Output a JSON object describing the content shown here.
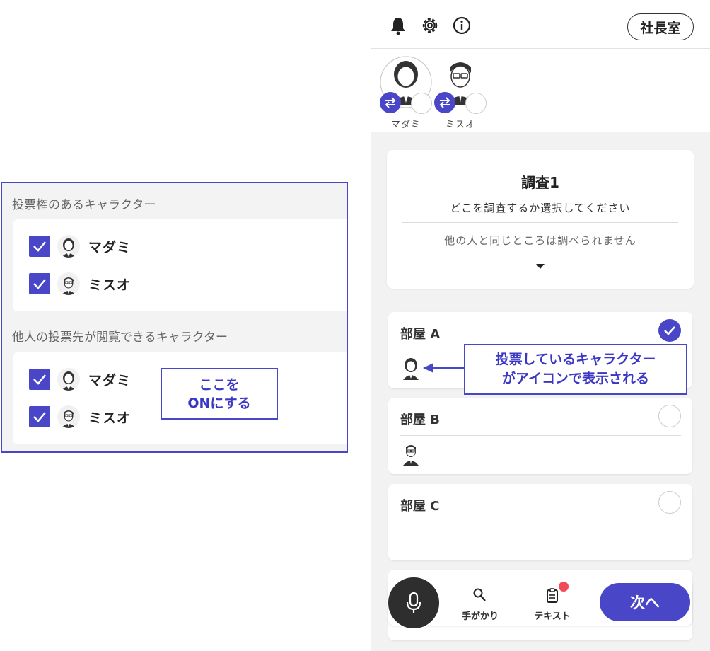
{
  "settings": {
    "voting_section_title": "投票権のあるキャラクター",
    "view_section_title": "他人の投票先が閲覧できるキャラクター",
    "voting_characters": [
      {
        "name": "マダミ",
        "checked": true
      },
      {
        "name": "ミスオ",
        "checked": true
      }
    ],
    "view_characters": [
      {
        "name": "マダミ",
        "checked": true
      },
      {
        "name": "ミスオ",
        "checked": true
      }
    ],
    "callout_line1": "ここを",
    "callout_line2": "ONにする"
  },
  "app": {
    "header": {
      "icons": [
        "bell-icon",
        "gear-icon",
        "info-icon"
      ],
      "room_button": "社長室"
    },
    "players": [
      {
        "name": "マダミ"
      },
      {
        "name": "ミスオ"
      }
    ],
    "survey": {
      "title": "調査1",
      "subtitle": "どこを調査するか選択してください",
      "note": "他の人と同じところは調べられません"
    },
    "rooms": [
      {
        "name": "部屋 A",
        "selected": true
      },
      {
        "name": "部屋 B",
        "selected": false
      },
      {
        "name": "部屋 C",
        "selected": false
      }
    ],
    "bottom_nav": {
      "clues_label": "手がかり",
      "text_label": "テキスト",
      "next_label": "次へ"
    },
    "annotation_line1": "投票しているキャラクター",
    "annotation_line2": "がアイコンで表示される"
  },
  "colors": {
    "accent": "#4a46c8",
    "badge": "#f24b57",
    "mic": "#2e2e2e"
  }
}
